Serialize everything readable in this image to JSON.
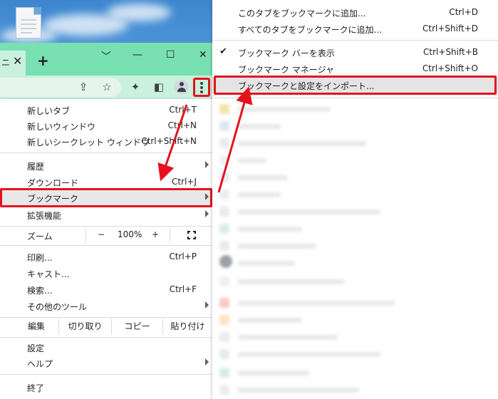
{
  "tab": {
    "title_fragment": "ニ"
  },
  "main_menu": {
    "items": [
      {
        "label": "新しいタブ",
        "shortcut": "Ctrl+T"
      },
      {
        "label": "新しいウィンドウ",
        "shortcut": "Ctrl+N"
      },
      {
        "label": "新しいシークレット ウィンドウ",
        "shortcut": "Ctrl+Shift+N"
      },
      {
        "label": "履歴",
        "shortcut": ""
      },
      {
        "label": "ダウンロード",
        "shortcut": "Ctrl+J"
      },
      {
        "label": "ブックマーク",
        "shortcut": ""
      },
      {
        "label": "拡張機能",
        "shortcut": ""
      },
      {
        "label": "印刷...",
        "shortcut": "Ctrl+P"
      },
      {
        "label": "キャスト...",
        "shortcut": ""
      },
      {
        "label": "検索...",
        "shortcut": "Ctrl+F"
      },
      {
        "label": "その他のツール",
        "shortcut": ""
      },
      {
        "label": "設定",
        "shortcut": ""
      },
      {
        "label": "ヘルプ",
        "shortcut": ""
      },
      {
        "label": "終了",
        "shortcut": ""
      }
    ],
    "zoom": {
      "label": "ズーム",
      "minus": "−",
      "value": "100%",
      "plus": "+"
    },
    "edit": {
      "label": "編集",
      "cut": "切り取り",
      "copy": "コピー",
      "paste": "貼り付け"
    }
  },
  "bookmarks_menu": {
    "items": [
      {
        "label": "このタブをブックマークに追加...",
        "shortcut": "Ctrl+D"
      },
      {
        "label": "すべてのタブをブックマークに追加...",
        "shortcut": "Ctrl+Shift+D"
      },
      {
        "label": "ブックマーク バーを表示",
        "shortcut": "Ctrl+Shift+B"
      },
      {
        "label": "ブックマーク マネージャ",
        "shortcut": "Ctrl+Shift+O"
      },
      {
        "label": "ブックマークと設定をインポート...",
        "shortcut": ""
      }
    ],
    "check_mark": "✔"
  },
  "colors": {
    "highlight": "#e5121d",
    "tabstrip": "#79e0b2",
    "toolbar": "#c9f1dd"
  }
}
